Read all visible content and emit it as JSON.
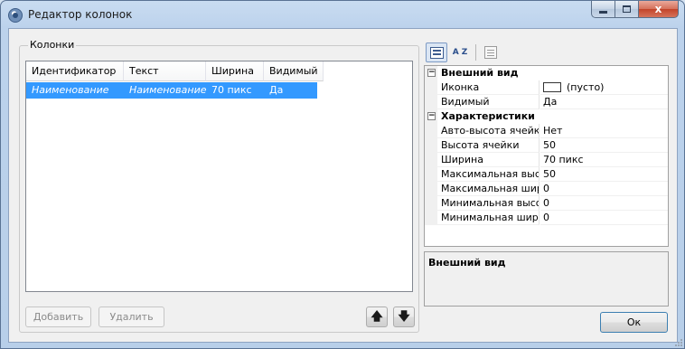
{
  "window": {
    "title": "Редактор колонок",
    "caption_buttons": [
      "minimize-icon",
      "maximize-icon",
      "close-icon"
    ],
    "close_glyph": "x"
  },
  "columns_group": {
    "title": "Колонки",
    "headers": [
      "Идентификатор",
      "Текст",
      "Ширина",
      "Видимый"
    ],
    "rows": [
      {
        "id": "Наименование",
        "text": "Наименование",
        "width": "70 пикс",
        "visible": "Да",
        "selected": true
      }
    ],
    "add_label": "Добавить",
    "delete_label": "Удалить",
    "up_glyph": "🡅",
    "down_glyph": "🡇"
  },
  "property_grid": {
    "toolbar": [
      "categorized-icon",
      "alphabetical-sort-icon",
      "property-pages-icon"
    ],
    "az_label": "A Z",
    "sections": [
      {
        "title": "Внешний вид",
        "toggle": "⊟",
        "rows": [
          {
            "name": "Иконка",
            "value": "(пусто)",
            "swatch": true
          },
          {
            "name": "Видимый",
            "value": "Да"
          }
        ]
      },
      {
        "title": "Характеристики",
        "toggle": "⊟",
        "rows": [
          {
            "name": "Авто-высота ячейки",
            "value": "Нет"
          },
          {
            "name": "Высота ячейки",
            "value": "50"
          },
          {
            "name": "Ширина",
            "value": "70 пикс"
          },
          {
            "name": "Максимальная высота",
            "value": "50"
          },
          {
            "name": "Максимальная ширина",
            "value": "0"
          },
          {
            "name": "Минимальная высота",
            "value": "0"
          },
          {
            "name": "Минимальная ширина",
            "value": "0"
          }
        ]
      }
    ],
    "help_title": "Внешний вид"
  },
  "ok_label": "Ок",
  "colors": {
    "selection": "#3399ff",
    "ok_border": "#3c7fb1",
    "close_button": "#c2442a"
  }
}
